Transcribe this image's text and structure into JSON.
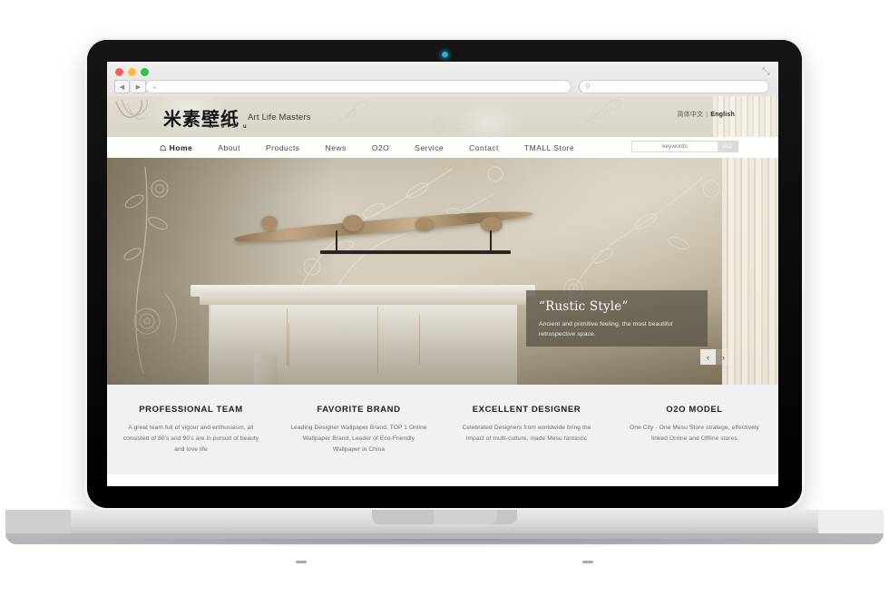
{
  "browser": {
    "traffic_lights": [
      "close",
      "minimize",
      "zoom"
    ],
    "back_label": "◀",
    "forward_label": "▶",
    "new_tab_label": "+",
    "url_value": "",
    "url_placeholder": "",
    "search_placeholder": "",
    "search_icon": "search-icon",
    "resize_icon": "⤡"
  },
  "header": {
    "logo_cn": "米素壁纸",
    "logo_sub": "m e s u",
    "tagline": "Art Life Masters",
    "lang_cn": "简体中文",
    "lang_sep": "|",
    "lang_en": "English"
  },
  "nav": {
    "items": [
      {
        "label": "Home",
        "active": true,
        "icon": "home-icon"
      },
      {
        "label": "About",
        "active": false
      },
      {
        "label": "Products",
        "active": false
      },
      {
        "label": "News",
        "active": false
      },
      {
        "label": "O2O",
        "active": false
      },
      {
        "label": "Service",
        "active": false
      },
      {
        "label": "Contact",
        "active": false
      },
      {
        "label": "TMALL Store",
        "active": false
      }
    ],
    "search_placeholder": "keywords",
    "search_value": "",
    "go_label": "GO"
  },
  "hero": {
    "promo_title": "“Rustic Style”",
    "promo_subtitle": "Ancient and primitive feeling, the most beautiful retrospective space.",
    "prev_label": "‹",
    "next_label": "›"
  },
  "features": [
    {
      "title": "PROFESSIONAL TEAM",
      "body": "A great team full of vigour and enthusiasm, all consisted of 80's and 90's are in pursuit of beauty and love life"
    },
    {
      "title": "FAVORITE BRAND",
      "body": "Leading Designer Wallpaper Brand, TOP 1 Online Wallpaper Brand, Leader of Eco-Friendly Wallpaper in China"
    },
    {
      "title": "EXCELLENT DESIGNER",
      "body": "Celebrated Designers from worldwide bring the impact of multi-culture, made Mesu fantastic"
    },
    {
      "title": "O2O MODEL",
      "body": "One City - One Mesu Store stratege, effectively linked Online and Offline stores"
    }
  ],
  "colors": {
    "header_bg": "#ddd9ce",
    "feature_bg": "#f1f1f1",
    "promo_overlay": "rgba(86,80,68,0.72)",
    "camera": "#24b7dd"
  }
}
